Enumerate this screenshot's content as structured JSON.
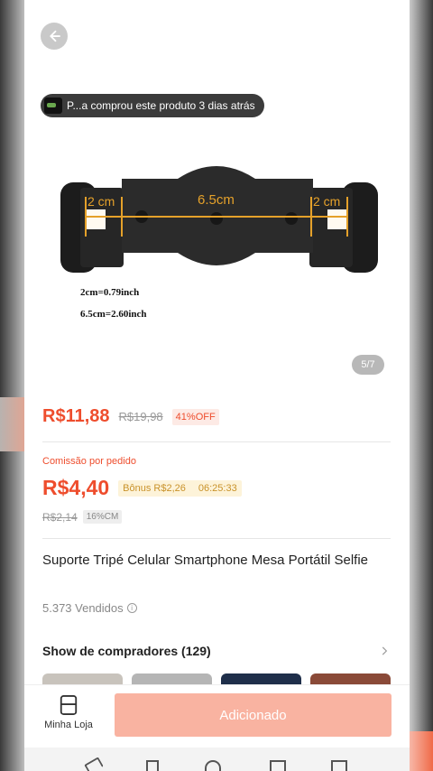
{
  "buyer_notice": "P...a comprou este produto 3 dias atrás",
  "image": {
    "counter": "5/7",
    "dim_left": "2 cm",
    "dim_center": "6.5cm",
    "dim_right": "2 cm",
    "conv1": "2cm=0.79inch",
    "conv2": "6.5cm=2.60inch"
  },
  "price": {
    "current": "R$11,88",
    "original": "R$19,98",
    "discount": "41%OFF"
  },
  "commission": {
    "label": "Comissão por pedido",
    "value": "R$4,40",
    "bonus": "Bônus R$2,26",
    "timer": "06:25:33",
    "original": "R$2,14",
    "rate": "16%CM"
  },
  "product": {
    "title": "Suporte Tripé Celular Smartphone Mesa Portátil Selfie",
    "sold": "5.373 Vendidos"
  },
  "buyers_show": {
    "title": "Show de compradores (129)"
  },
  "bottom": {
    "store_label": "Minha Loja",
    "add_button": "Adicionado"
  },
  "colors": {
    "accent": "#ee4d2d",
    "button_disabled": "#f9b3a1",
    "bonus_text": "#c9922a"
  }
}
